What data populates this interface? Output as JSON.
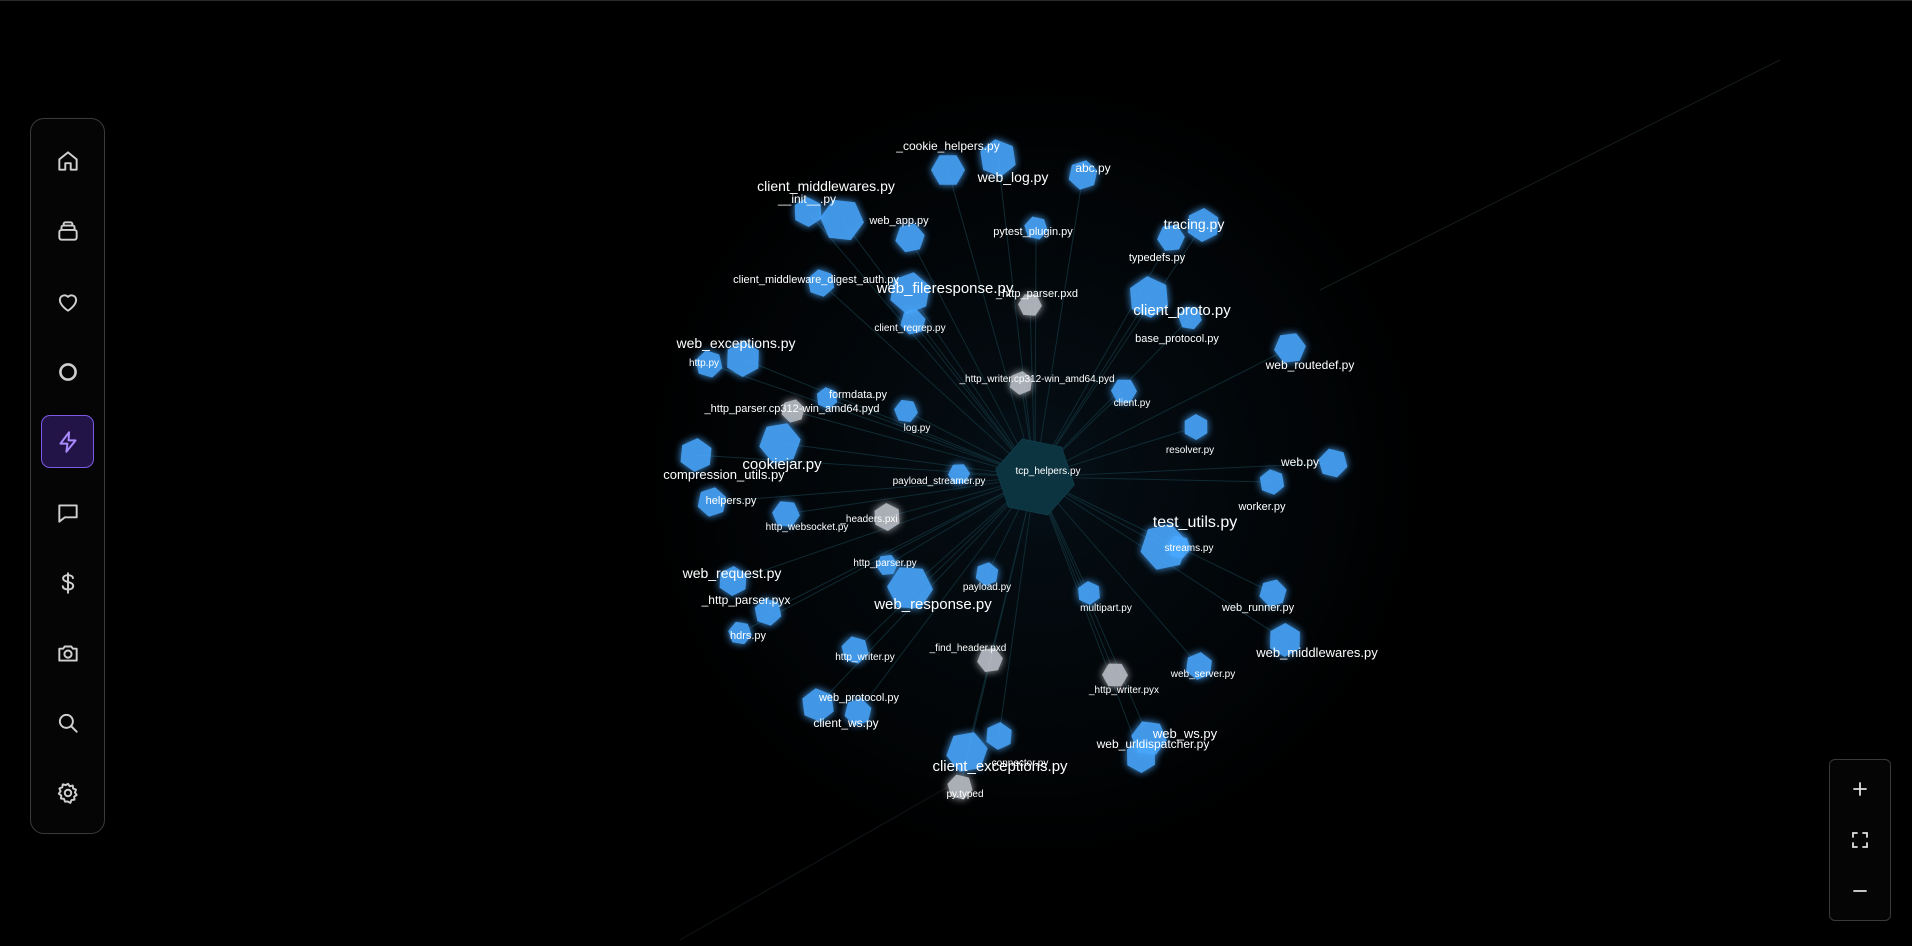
{
  "sidebar": {
    "items": [
      {
        "icon": "home-icon",
        "active": false
      },
      {
        "icon": "stack-icon",
        "active": false
      },
      {
        "icon": "heart-icon",
        "active": false
      },
      {
        "icon": "circle-icon",
        "active": false
      },
      {
        "icon": "lightning-icon",
        "active": true
      },
      {
        "icon": "chat-icon",
        "active": false
      },
      {
        "icon": "dollar-icon",
        "active": false
      },
      {
        "icon": "camera-icon",
        "active": false
      },
      {
        "icon": "search-icon",
        "active": false
      },
      {
        "icon": "gear-icon",
        "active": false
      }
    ]
  },
  "zoom_controls": {
    "items": [
      {
        "icon": "plus-icon"
      },
      {
        "icon": "fit-screen-icon"
      },
      {
        "icon": "minus-icon"
      }
    ]
  },
  "colors": {
    "file_node": "#4aa8ff",
    "binary_node": "#c8ccd4",
    "center_node": "#0c3340",
    "accent": "#7c5ae6"
  },
  "graph": {
    "center_label": "tcp_helpers.py",
    "nodes": [
      {
        "label": "_cookie_helpers.py",
        "kind": "file"
      },
      {
        "label": "web_log.py",
        "kind": "file"
      },
      {
        "label": "abc.py",
        "kind": "file"
      },
      {
        "label": "client_middlewares.py",
        "kind": "file"
      },
      {
        "label": "__init__.py",
        "kind": "file"
      },
      {
        "label": "web_app.py",
        "kind": "file"
      },
      {
        "label": "pytest_plugin.py",
        "kind": "file"
      },
      {
        "label": "tracing.py",
        "kind": "file"
      },
      {
        "label": "typedefs.py",
        "kind": "file"
      },
      {
        "label": "client_middleware_digest_auth.py",
        "kind": "file"
      },
      {
        "label": "web_fileresponse.py",
        "kind": "file"
      },
      {
        "label": "_http_parser.pxd",
        "kind": "binary"
      },
      {
        "label": "client_proto.py",
        "kind": "file"
      },
      {
        "label": "client_reqrep.py",
        "kind": "file"
      },
      {
        "label": "base_protocol.py",
        "kind": "file"
      },
      {
        "label": "web_exceptions.py",
        "kind": "file"
      },
      {
        "label": "web_routedef.py",
        "kind": "file"
      },
      {
        "label": "http.py",
        "kind": "file"
      },
      {
        "label": "_http_writer.cp312-win_amd64.pyd",
        "kind": "binary"
      },
      {
        "label": "client.py",
        "kind": "file"
      },
      {
        "label": "formdata.py",
        "kind": "file"
      },
      {
        "label": "_http_parser.cp312-win_amd64.pyd",
        "kind": "binary"
      },
      {
        "label": "log.py",
        "kind": "file"
      },
      {
        "label": "resolver.py",
        "kind": "file"
      },
      {
        "label": "cookiejar.py",
        "kind": "file"
      },
      {
        "label": "web.py",
        "kind": "file"
      },
      {
        "label": "compression_utils.py",
        "kind": "file"
      },
      {
        "label": "payload_streamer.py",
        "kind": "file"
      },
      {
        "label": "worker.py",
        "kind": "file"
      },
      {
        "label": "helpers.py",
        "kind": "file"
      },
      {
        "label": "http_websocket.py",
        "kind": "file"
      },
      {
        "label": "_headers.pxi",
        "kind": "binary"
      },
      {
        "label": "test_utils.py",
        "kind": "file"
      },
      {
        "label": "streams.py",
        "kind": "file"
      },
      {
        "label": "web_request.py",
        "kind": "file"
      },
      {
        "label": "http_parser.py",
        "kind": "file"
      },
      {
        "label": "_http_parser.pyx",
        "kind": "file"
      },
      {
        "label": "payload.py",
        "kind": "file"
      },
      {
        "label": "web_response.py",
        "kind": "file"
      },
      {
        "label": "multipart.py",
        "kind": "file"
      },
      {
        "label": "web_runner.py",
        "kind": "file"
      },
      {
        "label": "hdrs.py",
        "kind": "file"
      },
      {
        "label": "web_middlewares.py",
        "kind": "file"
      },
      {
        "label": "_find_header.pxd",
        "kind": "binary"
      },
      {
        "label": "http_writer.py",
        "kind": "file"
      },
      {
        "label": "web_server.py",
        "kind": "file"
      },
      {
        "label": "_http_writer.pyx",
        "kind": "binary"
      },
      {
        "label": "web_protocol.py",
        "kind": "file"
      },
      {
        "label": "client_ws.py",
        "kind": "file"
      },
      {
        "label": "web_ws.py",
        "kind": "file"
      },
      {
        "label": "web_urldispatcher.py",
        "kind": "file"
      },
      {
        "label": "client_exceptions.py",
        "kind": "file"
      },
      {
        "label": "py.typed",
        "kind": "binary"
      },
      {
        "label": "connector.py",
        "kind": "file"
      }
    ]
  }
}
